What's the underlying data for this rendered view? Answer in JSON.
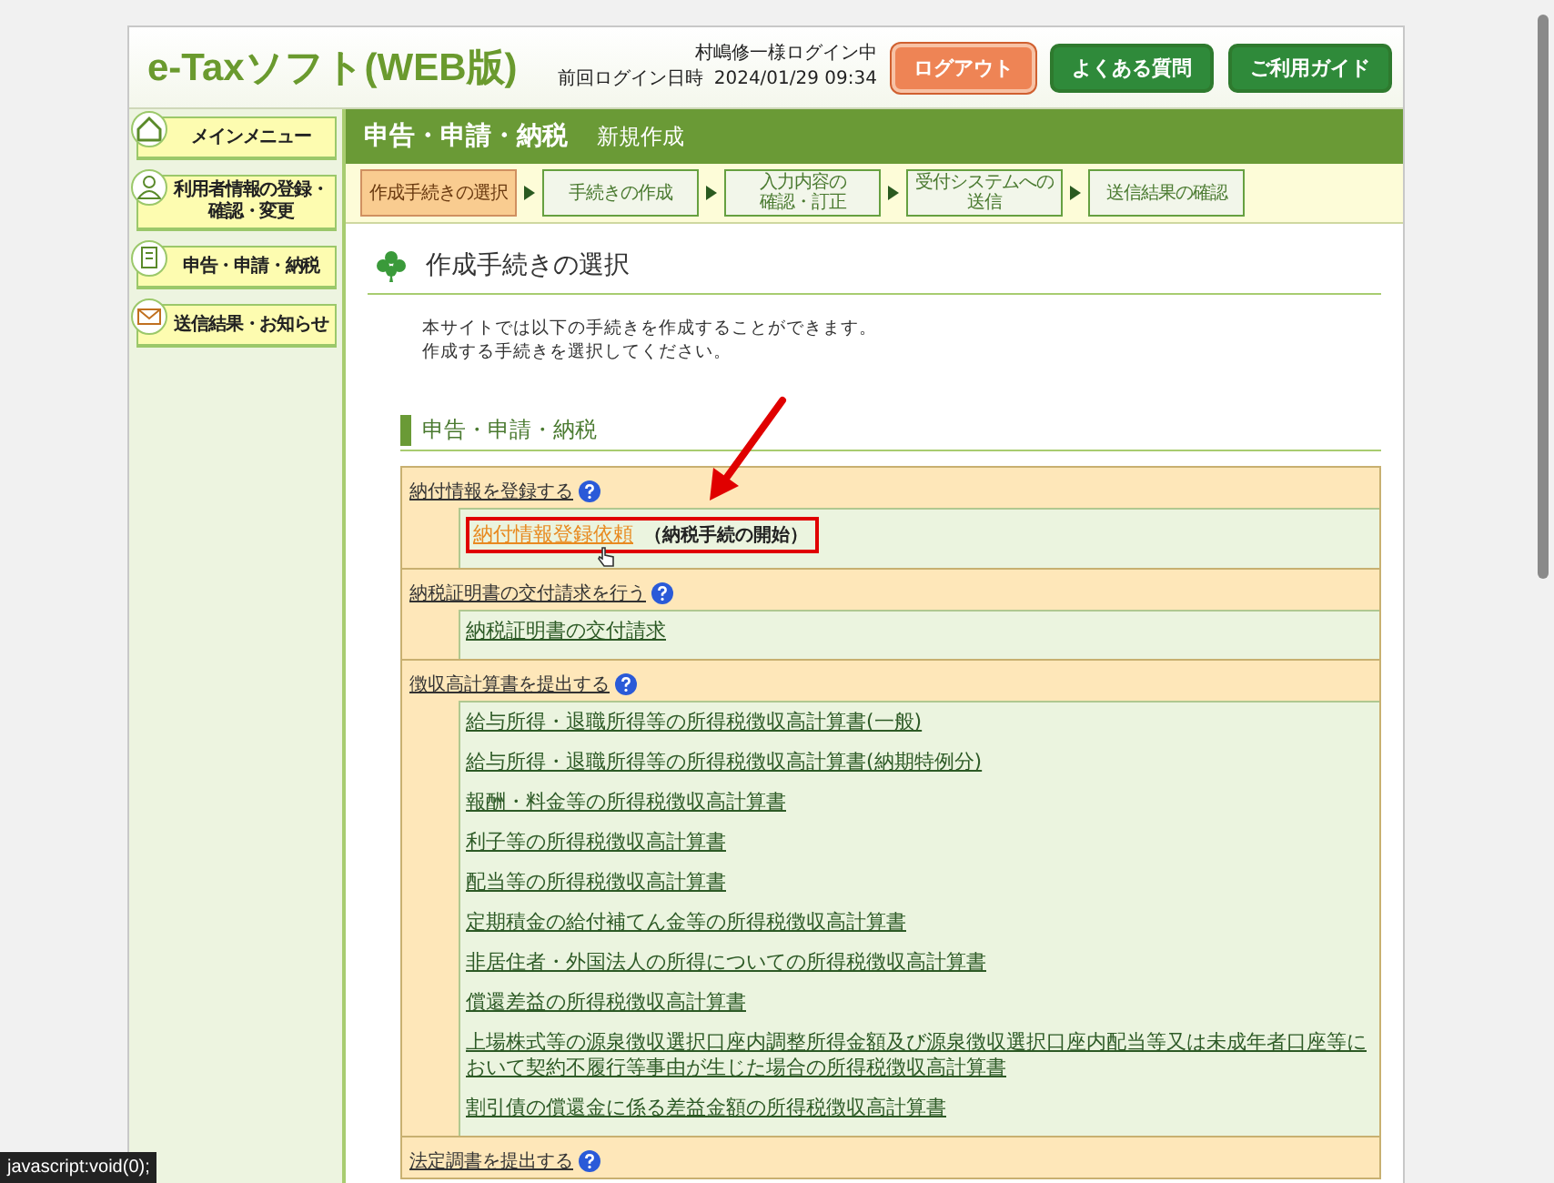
{
  "header": {
    "logo": "e-Taxソフト(WEB版)",
    "user": "村嶋修一様ログイン中",
    "last_login_label": "前回ログイン日時",
    "last_login": "2024/01/29 09:34",
    "buttons": [
      {
        "label": "ログアウト",
        "kind": "logout"
      },
      {
        "label": "よくある質問",
        "kind": "nav"
      },
      {
        "label": "ご利用ガイド",
        "kind": "nav"
      }
    ]
  },
  "sidebar": {
    "items": [
      {
        "label": "メインメニュー"
      },
      {
        "label": "利用者情報の登録・確認・変更"
      },
      {
        "label": "申告・申請・納税"
      },
      {
        "label": "送信結果・お知らせ"
      }
    ]
  },
  "title_bar": {
    "title": "申告・申請・納税",
    "subtitle": "新規作成"
  },
  "steps": [
    {
      "lines": [
        "作成手続きの選択"
      ],
      "selected": true
    },
    {
      "lines": [
        "手続きの作成"
      ],
      "selected": false
    },
    {
      "lines": [
        "入力内容の",
        "確認・訂正"
      ],
      "selected": false
    },
    {
      "lines": [
        "受付システムへの",
        "送信"
      ],
      "selected": false
    },
    {
      "lines": [
        "送信結果の確認"
      ],
      "selected": false
    }
  ],
  "page_heading": "作成手続きの選択",
  "intro": [
    "本サイトでは以下の手続きを作成することができます。",
    "作成する手続きを選択してください。"
  ],
  "section_heading": "申告・申請・納税",
  "groups": [
    {
      "title": "納付情報を登録する",
      "items": [
        {
          "label": "納付情報登録依頼",
          "note": "（納税手続の開始）",
          "hovered": true,
          "highlighted": true
        }
      ]
    },
    {
      "title": "納税証明書の交付請求を行う",
      "items": [
        {
          "label": "納税証明書の交付請求",
          "hovered": false,
          "highlighted": false
        }
      ]
    },
    {
      "title": "徴収高計算書を提出する",
      "items": [
        {
          "label": "給与所得・退職所得等の所得税徴収高計算書(一般)",
          "hovered": false,
          "highlighted": false
        },
        {
          "label": "給与所得・退職所得等の所得税徴収高計算書(納期特例分)",
          "hovered": false,
          "highlighted": false
        },
        {
          "label": "報酬・料金等の所得税徴収高計算書",
          "hovered": false,
          "highlighted": false
        },
        {
          "label": "利子等の所得税徴収高計算書",
          "hovered": false,
          "highlighted": false
        },
        {
          "label": "配当等の所得税徴収高計算書",
          "hovered": false,
          "highlighted": false
        },
        {
          "label": "定期積金の給付補てん金等の所得税徴収高計算書",
          "hovered": false,
          "highlighted": false
        },
        {
          "label": "非居住者・外国法人の所得についての所得税徴収高計算書",
          "hovered": false,
          "highlighted": false
        },
        {
          "label": "償還差益の所得税徴収高計算書",
          "hovered": false,
          "highlighted": false
        },
        {
          "label": "上場株式等の源泉徴収選択口座内調整所得金額及び源泉徴収選択口座内配当等又は未成年者口座等において契約不履行等事由が生じた場合の所得税徴収高計算書",
          "hovered": false,
          "highlighted": false
        },
        {
          "label": "割引債の償還金に係る差益金額の所得税徴収高計算書",
          "hovered": false,
          "highlighted": false
        }
      ]
    },
    {
      "title": "法定調書を提出する"
    }
  ],
  "status_bar": "javascript:void(0);"
}
